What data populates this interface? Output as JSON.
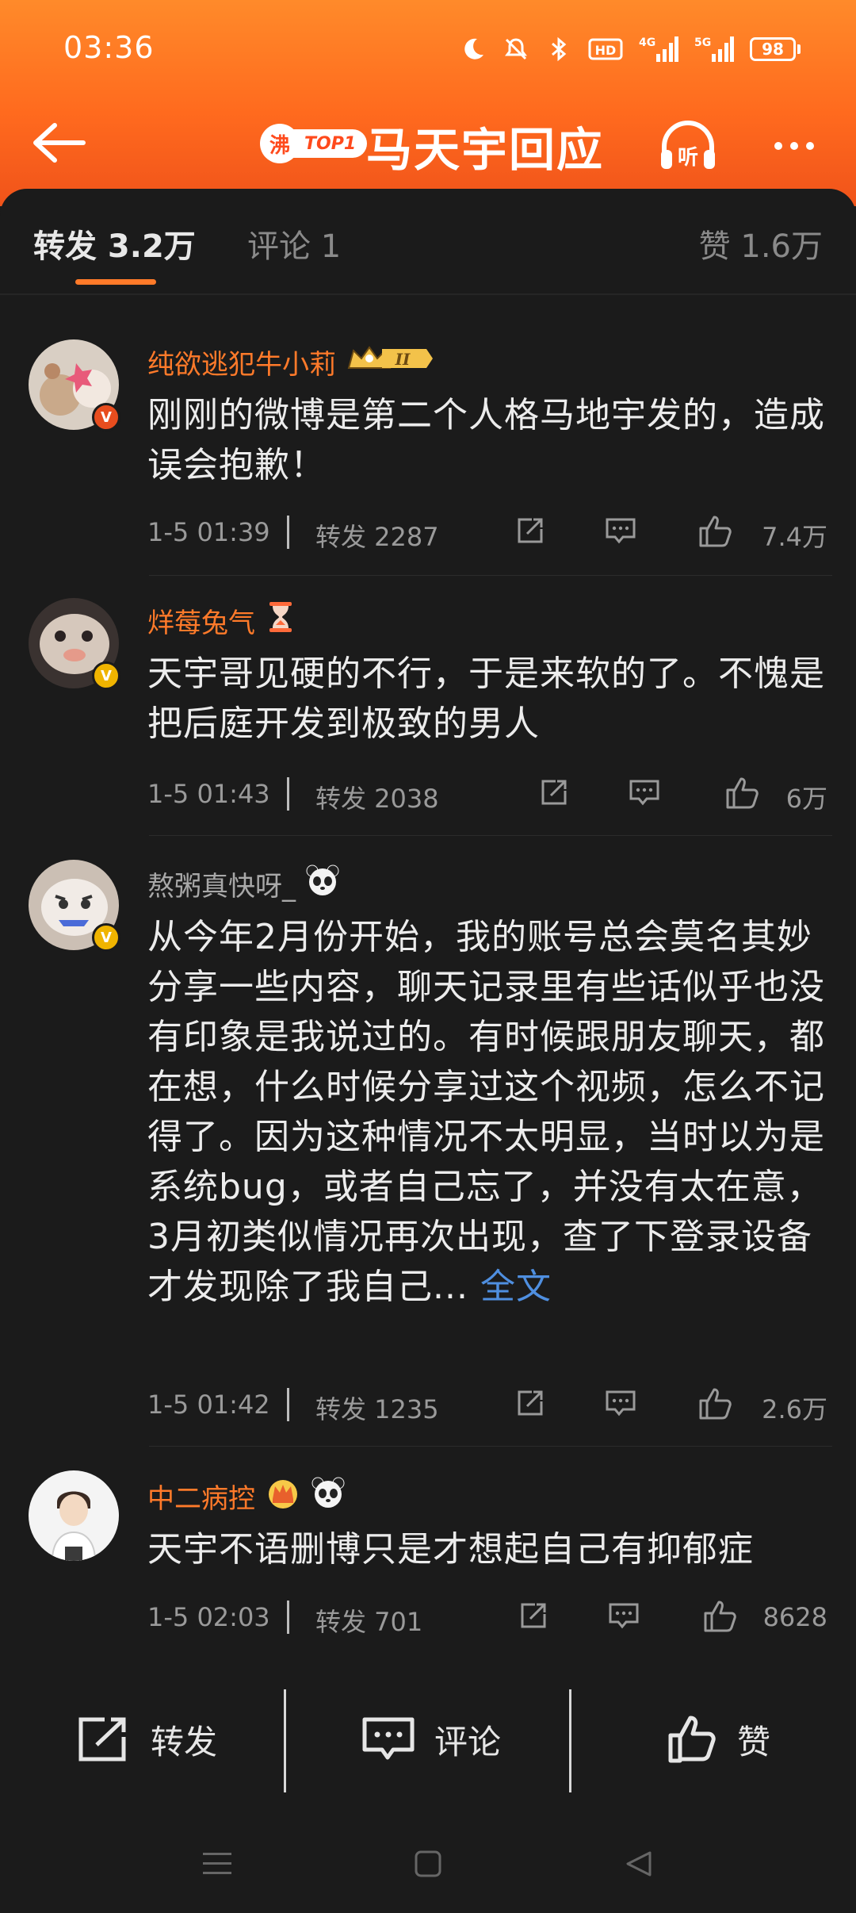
{
  "status_bar": {
    "time": "03:36",
    "icons": [
      "moon-icon",
      "mute-icon",
      "bluetooth-icon",
      "hd-icon",
      "signal-4g-icon",
      "signal-5g-icon"
    ],
    "battery": "98"
  },
  "header": {
    "hot_badge": "沸",
    "top_label": "TOP1",
    "title": "马天宇回应",
    "listen_label": "听"
  },
  "tabs": {
    "repost": "转发 3.2万",
    "comments": "评论 1",
    "likes": "赞 1.6万"
  },
  "comments": [
    {
      "user": "纯欲逃犯牛小莉",
      "badge_level": "II",
      "verify": "V",
      "text": "刚刚的微博是第二个人格马地宇发的，造成误会抱歉！",
      "time": "1-5 01:39",
      "repost": "转发 2287",
      "likes": "7.4万"
    },
    {
      "user": "烊莓兔气",
      "verify": "V",
      "text": "天宇哥见硬的不行，于是来软的了。不愧是把后庭开发到极致的男人",
      "time": "1-5 01:43",
      "repost": "转发 2038",
      "likes": "6万"
    },
    {
      "user": "熬粥真快呀_",
      "verify": "V",
      "text": "从今年2月份开始，我的账号总会莫名其妙分享一些内容，聊天记录里有些话似乎也没有印象是我说过的。有时候跟朋友聊天，都在想，什么时候分享过这个视频，怎么不记得了。因为这种情况不太明显，当时以为是系统bug，或者自己忘了，并没有太在意，3月初类似情况再次出现，查了下登录设备才发现除了我自己...",
      "more": " 全文",
      "time": "1-5 01:42",
      "repost": "转发 1235",
      "likes": "2.6万"
    },
    {
      "user": "中二病控",
      "text": "天宇不语删博只是才想起自己有抑郁症",
      "time": "1-5 02:03",
      "repost": "转发 701",
      "likes": "8628"
    }
  ],
  "action_bar": {
    "repost": "转发",
    "comment": "评论",
    "like": "赞"
  },
  "colors": {
    "header_gradient_top": "#ff8a2a",
    "header_gradient_bottom": "#f0531a",
    "background": "#1b1b1b",
    "username": "#ff7a2a",
    "link": "#4f8fe0"
  }
}
